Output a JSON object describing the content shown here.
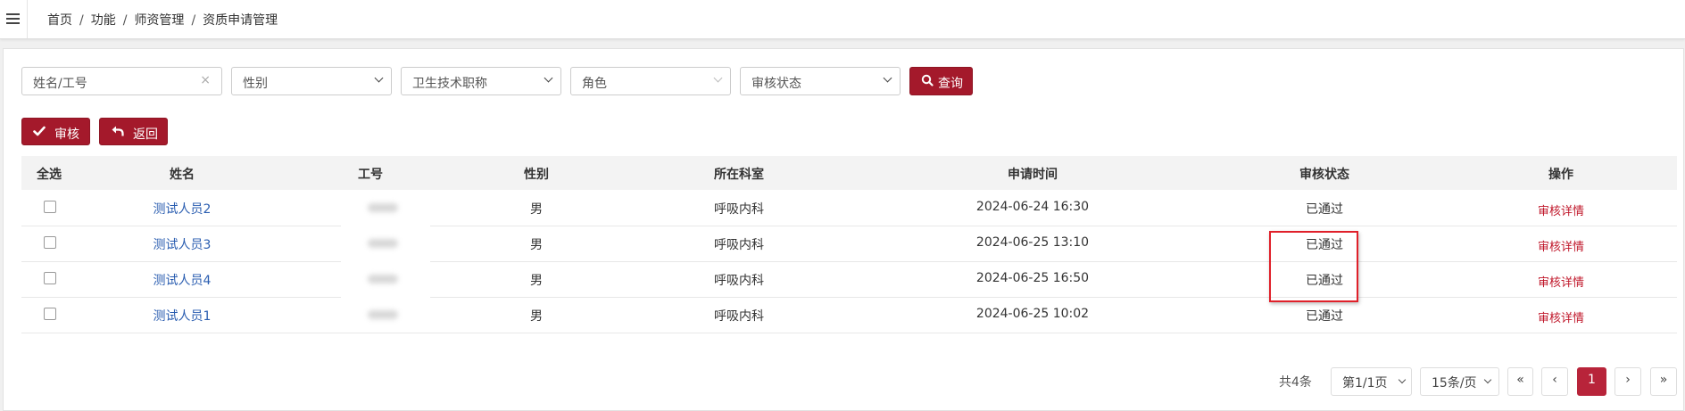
{
  "breadcrumb": {
    "items": [
      "首页",
      "功能",
      "师资管理",
      "资质申请管理"
    ],
    "separator": "/"
  },
  "search": {
    "name_placeholder": "姓名/工号",
    "clear_icon": "×",
    "gender_label": "性别",
    "title_label": "卫生技术职称",
    "role_label": "角色",
    "status_label": "审核状态",
    "query_label": "查询"
  },
  "actions": {
    "review_label": "审核",
    "back_label": "返回"
  },
  "table": {
    "headers": [
      "全选",
      "姓名",
      "工号",
      "性别",
      "所在科室",
      "申请时间",
      "审核状态",
      "操作"
    ],
    "rows": [
      {
        "name": "测试人员2",
        "gender": "男",
        "dept": "呼吸内科",
        "time": "2024-06-24 16:30",
        "status": "已通过",
        "op": "审核详情"
      },
      {
        "name": "测试人员3",
        "gender": "男",
        "dept": "呼吸内科",
        "time": "2024-06-25 13:10",
        "status": "已通过",
        "op": "审核详情"
      },
      {
        "name": "测试人员4",
        "gender": "男",
        "dept": "呼吸内科",
        "time": "2024-06-25 16:50",
        "status": "已通过",
        "op": "审核详情"
      },
      {
        "name": "测试人员1",
        "gender": "男",
        "dept": "呼吸内科",
        "time": "2024-06-25 10:02",
        "status": "已通过",
        "op": "审核详情"
      }
    ]
  },
  "pagination": {
    "total": "共4条",
    "page_info": "第1/1页",
    "page_size": "15条/页",
    "first": "«",
    "prev": "‹",
    "current": "1",
    "next": "›",
    "last": "»"
  },
  "colors": {
    "accent": "#a4192b",
    "link": "#2a5db0",
    "highlight": "#e0202a"
  },
  "icons": [
    "menu-icon",
    "clear-icon",
    "chevron-down-icon",
    "search-icon",
    "check-icon",
    "reply-icon"
  ]
}
